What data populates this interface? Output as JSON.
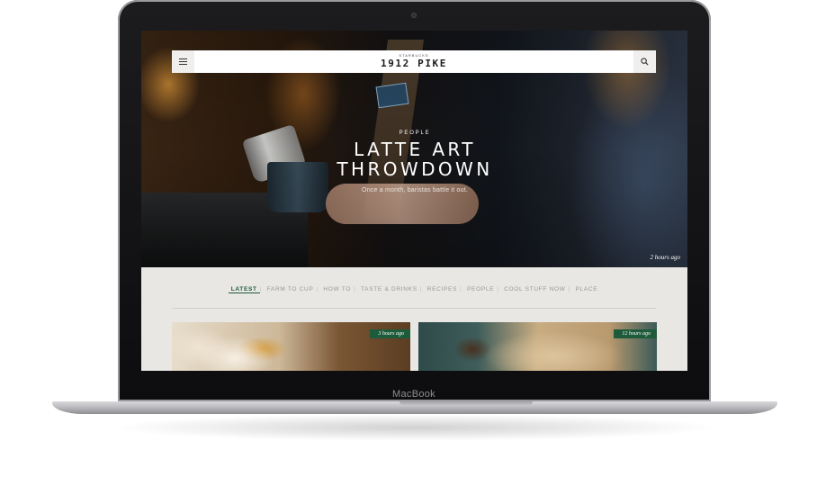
{
  "device": {
    "chin_label": "MacBook"
  },
  "site": {
    "brand_small": "STARBUCKS",
    "brand_big": "1912 PIKE"
  },
  "nav": {
    "menu_icon": "hamburger-menu-icon",
    "search_icon": "search-icon"
  },
  "hero": {
    "kicker": "PEOPLE",
    "headline_line1": "LATTE ART",
    "headline_line2": "THROWDOWN",
    "subhead": "Once a month, baristas battle it out.",
    "timestamp": "2 hours ago"
  },
  "categories": [
    {
      "label": "LATEST",
      "active": true
    },
    {
      "label": "FARM TO CUP",
      "active": false
    },
    {
      "label": "HOW TO",
      "active": false
    },
    {
      "label": "TASTE & DRINKS",
      "active": false
    },
    {
      "label": "RECIPES",
      "active": false
    },
    {
      "label": "PEOPLE",
      "active": false
    },
    {
      "label": "COOL STUFF NOW",
      "active": false
    },
    {
      "label": "PLACE",
      "active": false
    }
  ],
  "cards": [
    {
      "timestamp": "3 hours ago"
    },
    {
      "timestamp": "12 hours ago"
    }
  ],
  "colors": {
    "accent_green": "#1e5b3a",
    "page_bg": "#e9e7e4"
  }
}
